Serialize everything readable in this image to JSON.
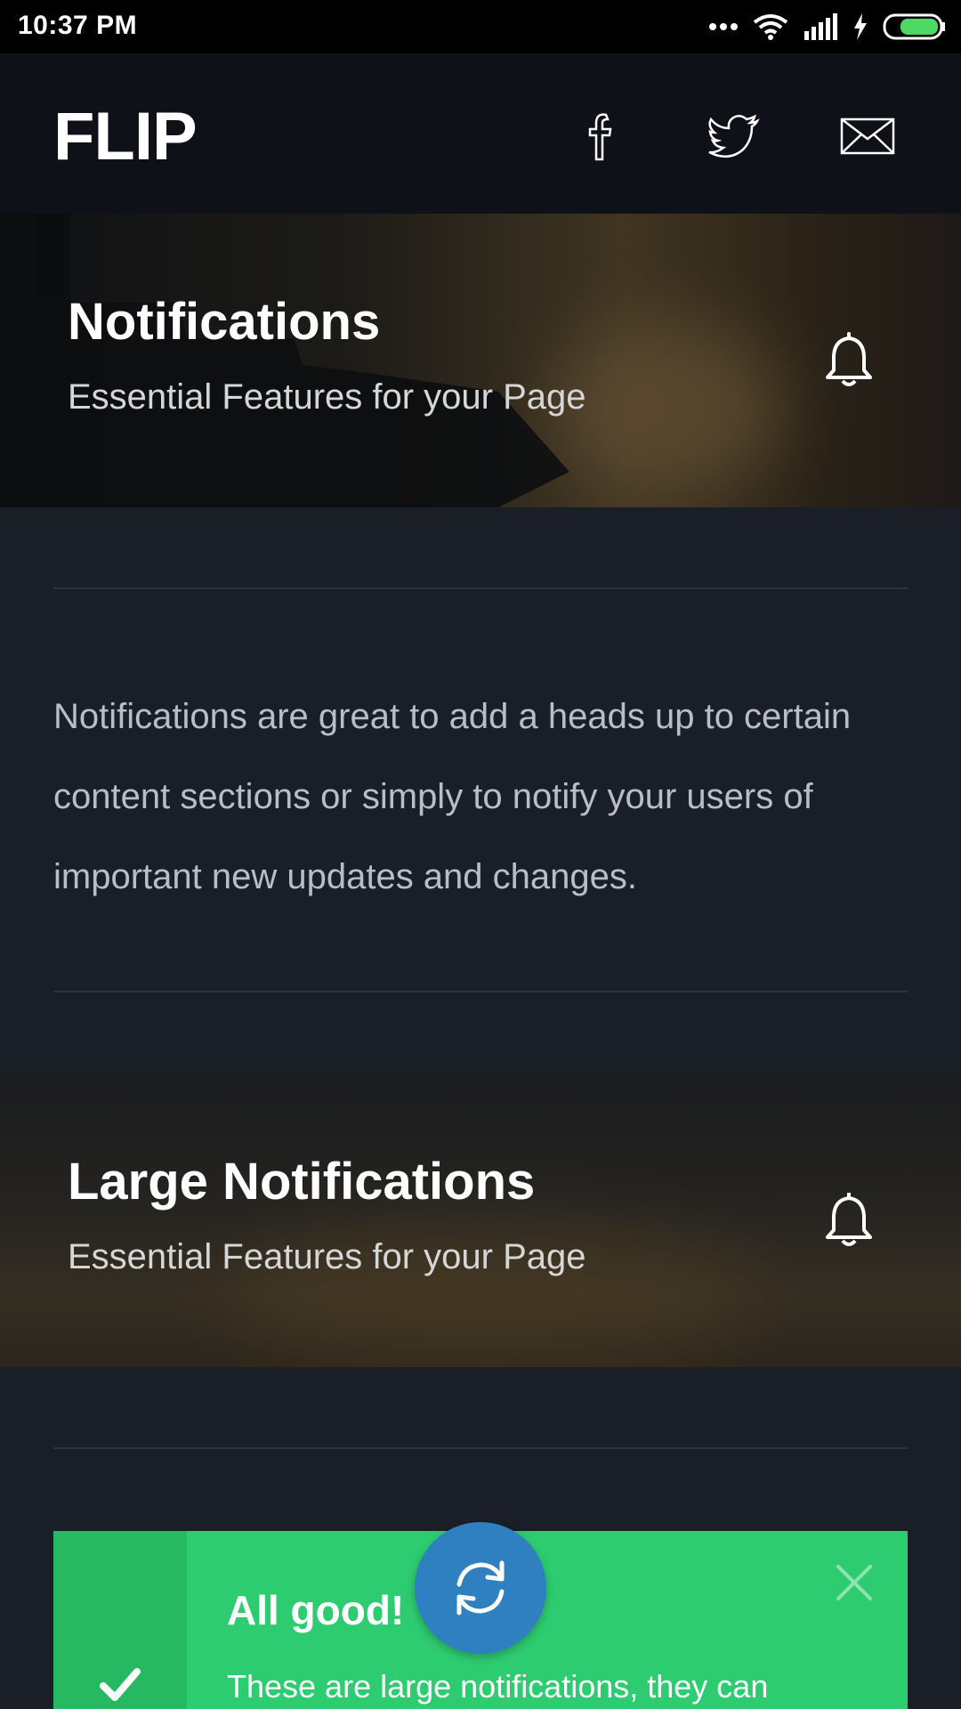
{
  "status_bar": {
    "time": "10:37 PM"
  },
  "header": {
    "brand": "FLIP",
    "social": [
      "facebook-icon",
      "twitter-icon",
      "mail-icon"
    ]
  },
  "section1": {
    "title": "Notifications",
    "subtitle": "Essential Features for your Page",
    "icon": "bell-icon"
  },
  "intro_text": "Notifications are great to add a heads up to certain content sections or simply to notify your users of important new updates and changes.",
  "section2": {
    "title": "Large Notifications",
    "subtitle": "Essential Features for your Page",
    "icon": "bell-icon"
  },
  "notification": {
    "title": "All good!",
    "text": "These are large notifications, they can",
    "color": "#2ecc71",
    "side_color": "#27b862"
  },
  "fab": {
    "icon": "refresh-icon",
    "color": "#2e80c0"
  }
}
